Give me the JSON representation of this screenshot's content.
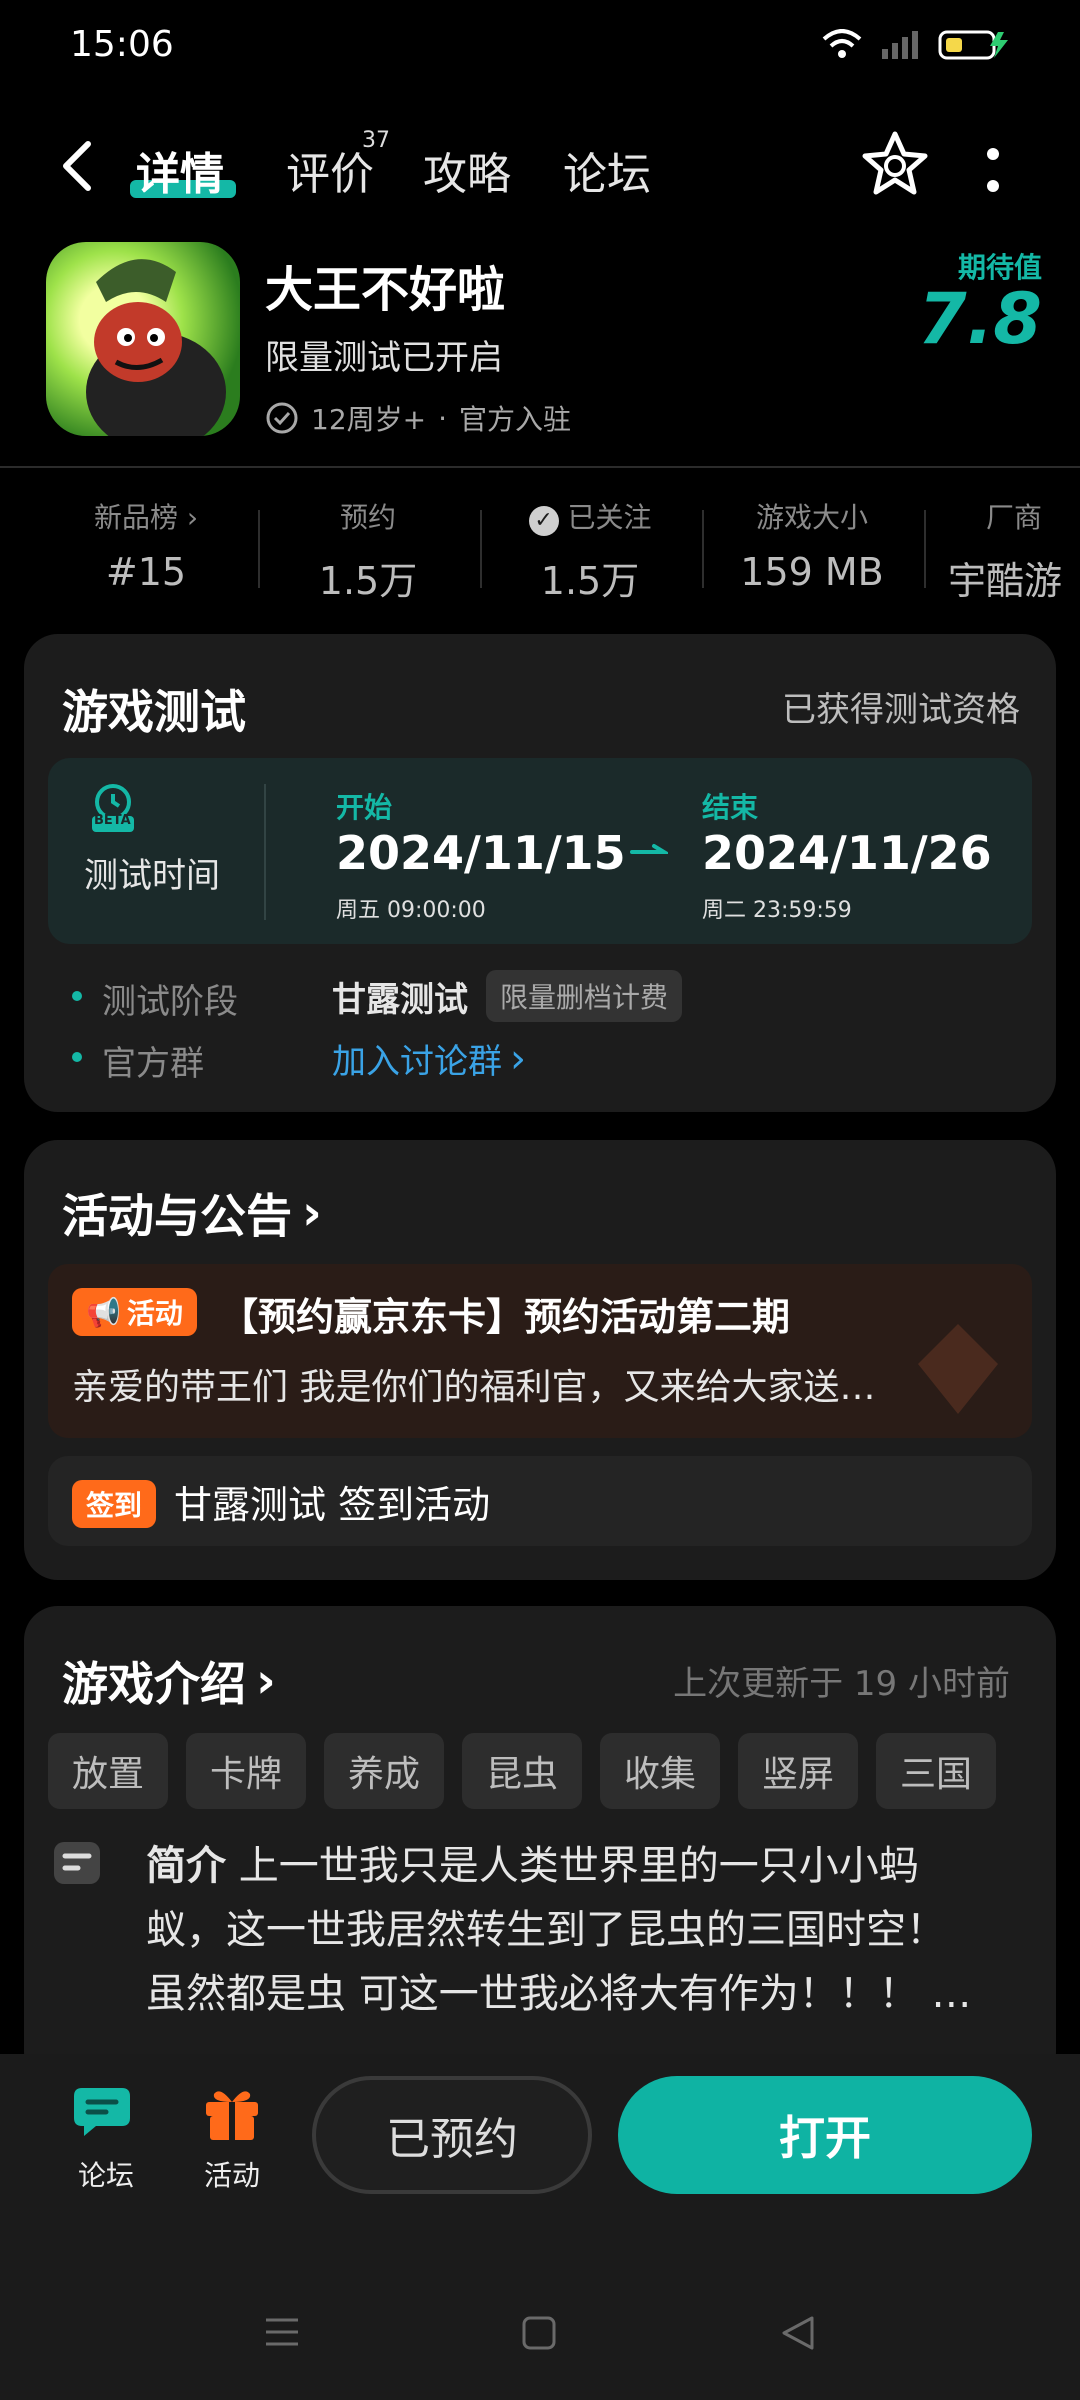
{
  "status_bar": {
    "time": "15:06"
  },
  "nav": {
    "tabs": [
      "详情",
      "评价",
      "攻略",
      "论坛"
    ],
    "review_count": "37"
  },
  "app": {
    "title": "大王不好啦",
    "subtitle": "限量测试已开启",
    "age": "12周岁+",
    "official": "官方入驻",
    "expect_label": "期待值",
    "expect_value": "7.8"
  },
  "stats": [
    {
      "label": "新品榜",
      "value": "#15"
    },
    {
      "label": "预约",
      "value": "1.5万"
    },
    {
      "label": "已关注",
      "value": "1.5万"
    },
    {
      "label": "游戏大小",
      "value": "159 MB"
    },
    {
      "label": "厂商",
      "value": "宇酷游"
    }
  ],
  "test_card": {
    "title": "游戏测试",
    "qualified": "已获得测试资格",
    "badge": "BETA",
    "time_label": "测试时间",
    "start_label": "开始",
    "start_date": "2024/11/15",
    "start_detail": "周五  09:00:00",
    "end_label": "结束",
    "end_date": "2024/11/26",
    "end_detail": "周二  23:59:59",
    "stage_label": "测试阶段",
    "stage_value": "甘露测试",
    "stage_tag": "限量删档计费",
    "group_label": "官方群",
    "group_link": "加入讨论群"
  },
  "activity_card": {
    "title": "活动与公告",
    "act_tag": "活动",
    "act_title": "【预约赢京东卡】预约活动第二期",
    "act_desc": "亲爱的带王们 我是你们的福利官，又来给大家送…",
    "sign_tag": "签到",
    "sign_title": "甘露测试 签到活动"
  },
  "intro_card": {
    "title": "游戏介绍",
    "updated": "上次更新于 19 小时前",
    "tags": [
      "放置",
      "卡牌",
      "养成",
      "昆虫",
      "收集",
      "竖屏",
      "三国"
    ],
    "intro_label": "简介",
    "intro_line1": "上一世我只是人类世界里的一只小小蚂",
    "intro_line2": "蚁，这一世我居然转生到了昆虫的三国时空！",
    "intro_line3": "虽然都是虫 可这一世我必将大有作为！！！ …"
  },
  "bottom": {
    "forum": "论坛",
    "activity": "活动",
    "booked": "已预约",
    "open": "打开"
  },
  "colors": {
    "accent": "#14b8a6",
    "orange": "#ff6a1a",
    "link": "#3aa3e6"
  }
}
